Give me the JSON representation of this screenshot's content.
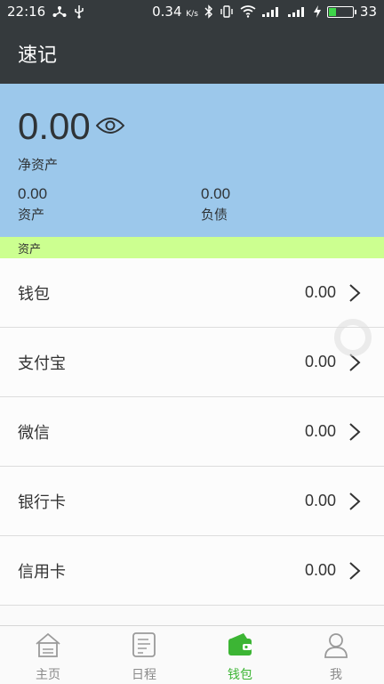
{
  "status_bar": {
    "time": "22:16",
    "net_speed": "0.34",
    "net_unit": "K/s",
    "battery_level": "33",
    "battery_fraction": 0.33,
    "icons": [
      "usb-share-icon",
      "usb-icon",
      "bluetooth-icon",
      "vibrate-icon",
      "wifi-icon",
      "signal-icon",
      "signal-2-icon",
      "charging-icon",
      "battery-icon"
    ]
  },
  "app_bar": {
    "title": "速记"
  },
  "summary": {
    "net_worth_value": "0.00",
    "net_worth_label": "净资产",
    "assets_value": "0.00",
    "assets_label": "资产",
    "debts_value": "0.00",
    "debts_label": "负债",
    "background_color": "#9cc8eb"
  },
  "section": {
    "title": "资产",
    "background_color": "#ccff90"
  },
  "accounts": [
    {
      "name": "钱包",
      "amount": "0.00"
    },
    {
      "name": "支付宝",
      "amount": "0.00"
    },
    {
      "name": "微信",
      "amount": "0.00"
    },
    {
      "name": "银行卡",
      "amount": "0.00"
    },
    {
      "name": "信用卡",
      "amount": "0.00"
    }
  ],
  "tabbar": {
    "tabs": [
      {
        "label": "主页",
        "icon": "home-icon",
        "active": false
      },
      {
        "label": "日程",
        "icon": "schedule-icon",
        "active": false
      },
      {
        "label": "钱包",
        "icon": "wallet-icon",
        "active": true
      },
      {
        "label": "我",
        "icon": "user-icon",
        "active": false
      }
    ],
    "active_color": "#3cb534"
  }
}
